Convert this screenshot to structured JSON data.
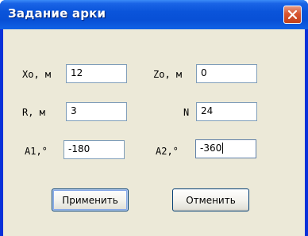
{
  "window": {
    "title": "Задание арки",
    "close_icon": "close-icon"
  },
  "form": {
    "xo": {
      "label": "Xo, м",
      "value": "12"
    },
    "zo": {
      "label": "Zo, м",
      "value": "0"
    },
    "r": {
      "label": "R, м",
      "value": "3"
    },
    "n": {
      "label": "N",
      "value": "24"
    },
    "a1": {
      "label": "A1,°",
      "value": "-180"
    },
    "a2": {
      "label": "A2,°",
      "value": "-360"
    }
  },
  "buttons": {
    "apply": "Применить",
    "cancel": "Отменить"
  },
  "colors": {
    "titlebar": "#0a54da",
    "client_bg": "#ece9d8",
    "close_button": "#d8552f",
    "field_border": "#7f9db9"
  }
}
